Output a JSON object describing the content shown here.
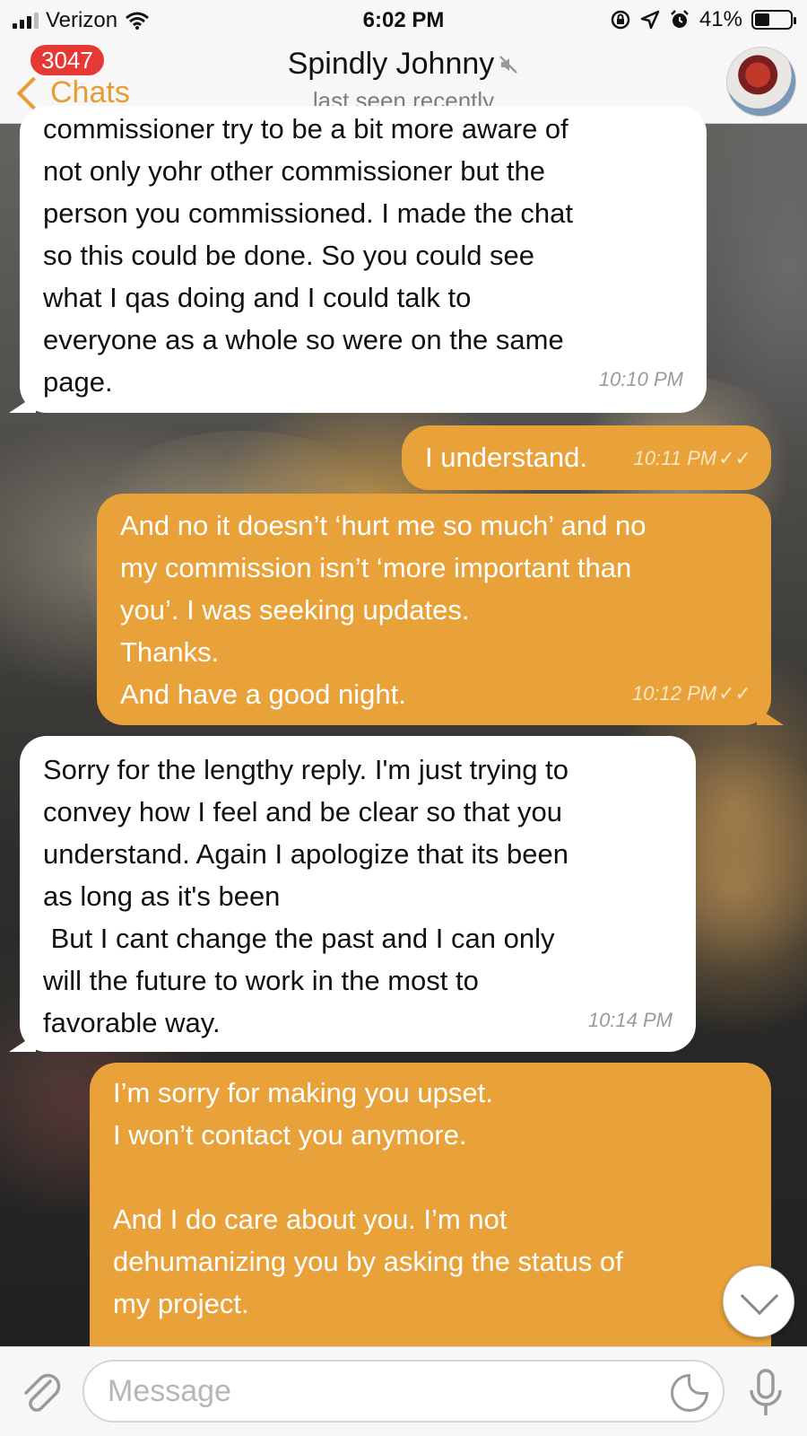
{
  "status_bar": {
    "carrier": "Verizon",
    "time": "6:02 PM",
    "battery_percent": "41%",
    "battery_level": 0.41
  },
  "header": {
    "back_label": "Chats",
    "unread_count": "3047",
    "title": "Spindly Johnny",
    "status": "last seen recently",
    "muted": true
  },
  "messages": [
    {
      "direction": "in",
      "text": "commissioner try to be a bit more aware of\nnot only yohr other commissioner but the\nperson you commissioned. I made the chat\nso this could be done. So you could see\nwhat I qas doing and I could talk to\neveryone as a whole so were on the same\npage.",
      "time": "10:10 PM"
    },
    {
      "direction": "out",
      "text": "I understand.",
      "time": "10:11 PM",
      "read": true
    },
    {
      "direction": "out",
      "text": "And no it doesn’t ‘hurt me so much’ and no\nmy commission isn’t ‘more important than\nyou’. I was seeking updates.\nThanks.\nAnd have a good night.",
      "time": "10:12 PM",
      "read": true
    },
    {
      "direction": "in",
      "text": "Sorry for the lengthy reply. I'm just trying to\nconvey how I feel and be clear so that you\nunderstand. Again I apologize that its been\nas long as it's been\n But I cant change the past and I can only\nwill the future to work in the most to\nfavorable way.",
      "time": "10:14 PM"
    },
    {
      "direction": "out",
      "text": "I’m sorry for making you upset.\nI won’t contact you anymore.\n\nAnd I do care about you. I’m not\ndehumanizing you by asking the status of\nmy project.",
      "time": ""
    }
  ],
  "composer": {
    "placeholder": "Message"
  },
  "colors": {
    "accent": "#e89d34",
    "outgoing_bubble": "#e9a239",
    "incoming_bubble": "#ffffff",
    "badge": "#e53935"
  },
  "icons": {
    "back": "chevron-left-icon",
    "mute": "mute-icon",
    "attach": "paperclip-icon",
    "sticker": "sticker-icon",
    "mic": "microphone-icon",
    "scroll": "chevron-down-icon"
  }
}
